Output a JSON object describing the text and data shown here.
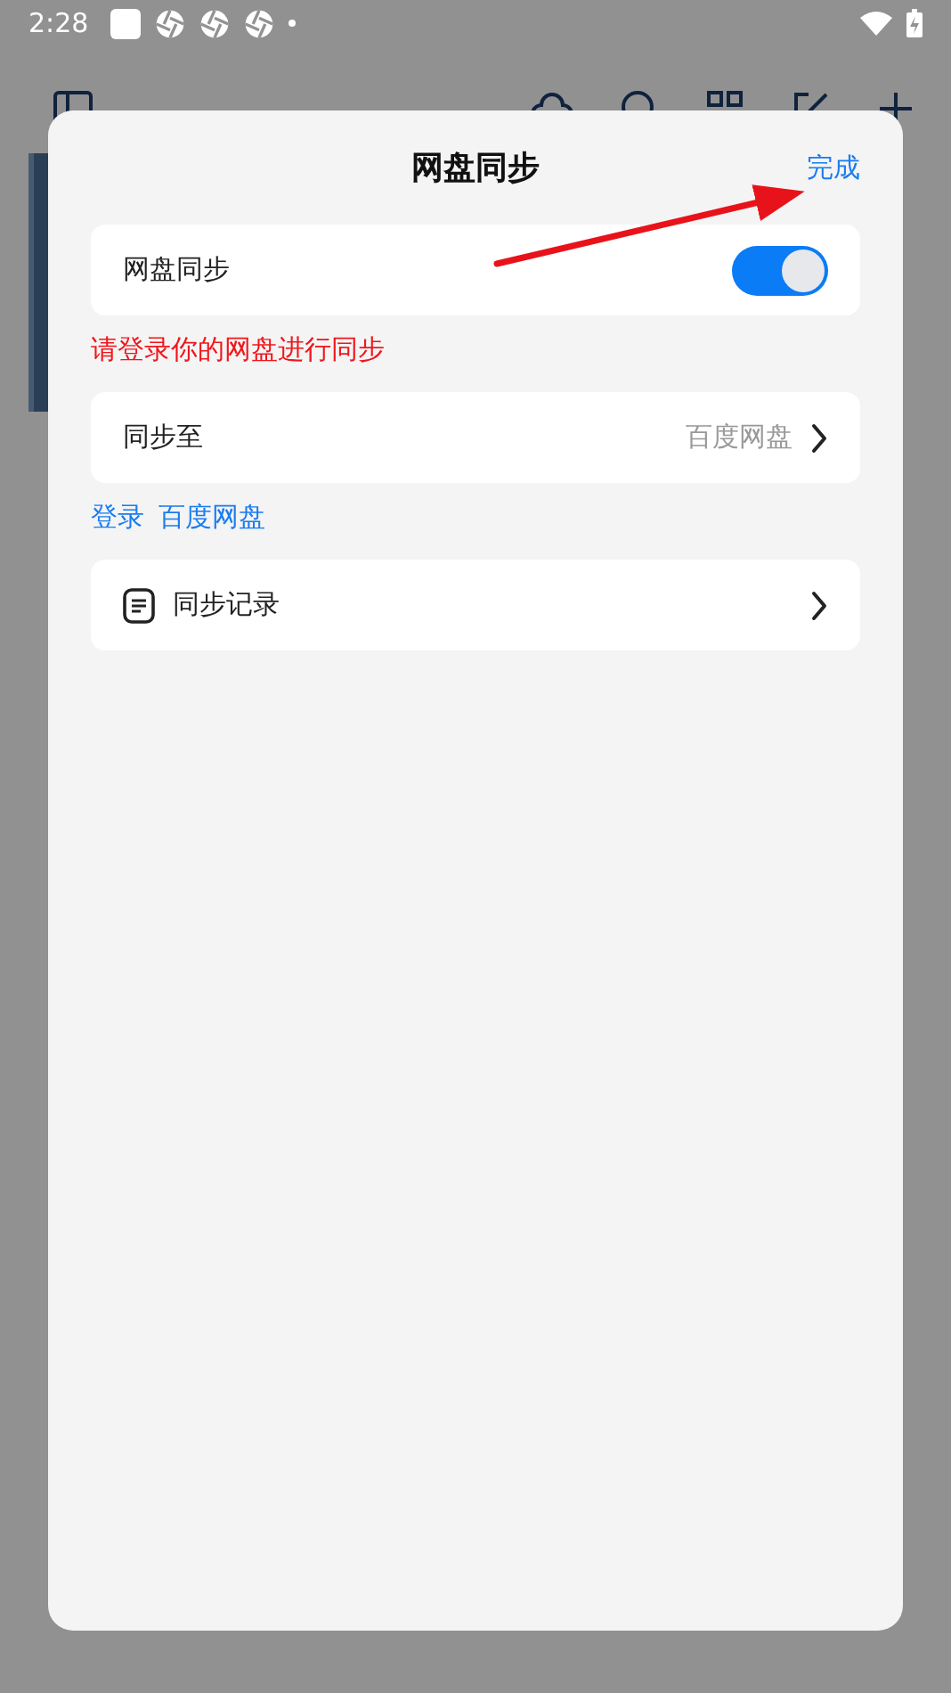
{
  "status_bar": {
    "time": "2:28"
  },
  "sheet": {
    "title": "网盘同步",
    "done": "完成",
    "sync_row": {
      "label": "网盘同步",
      "on": true
    },
    "warning": "请登录你的网盘进行同步",
    "target_row": {
      "label": "同步至",
      "value": "百度网盘"
    },
    "login_links": [
      "登录",
      "百度网盘"
    ],
    "history_row": {
      "label": "同步记录"
    }
  }
}
